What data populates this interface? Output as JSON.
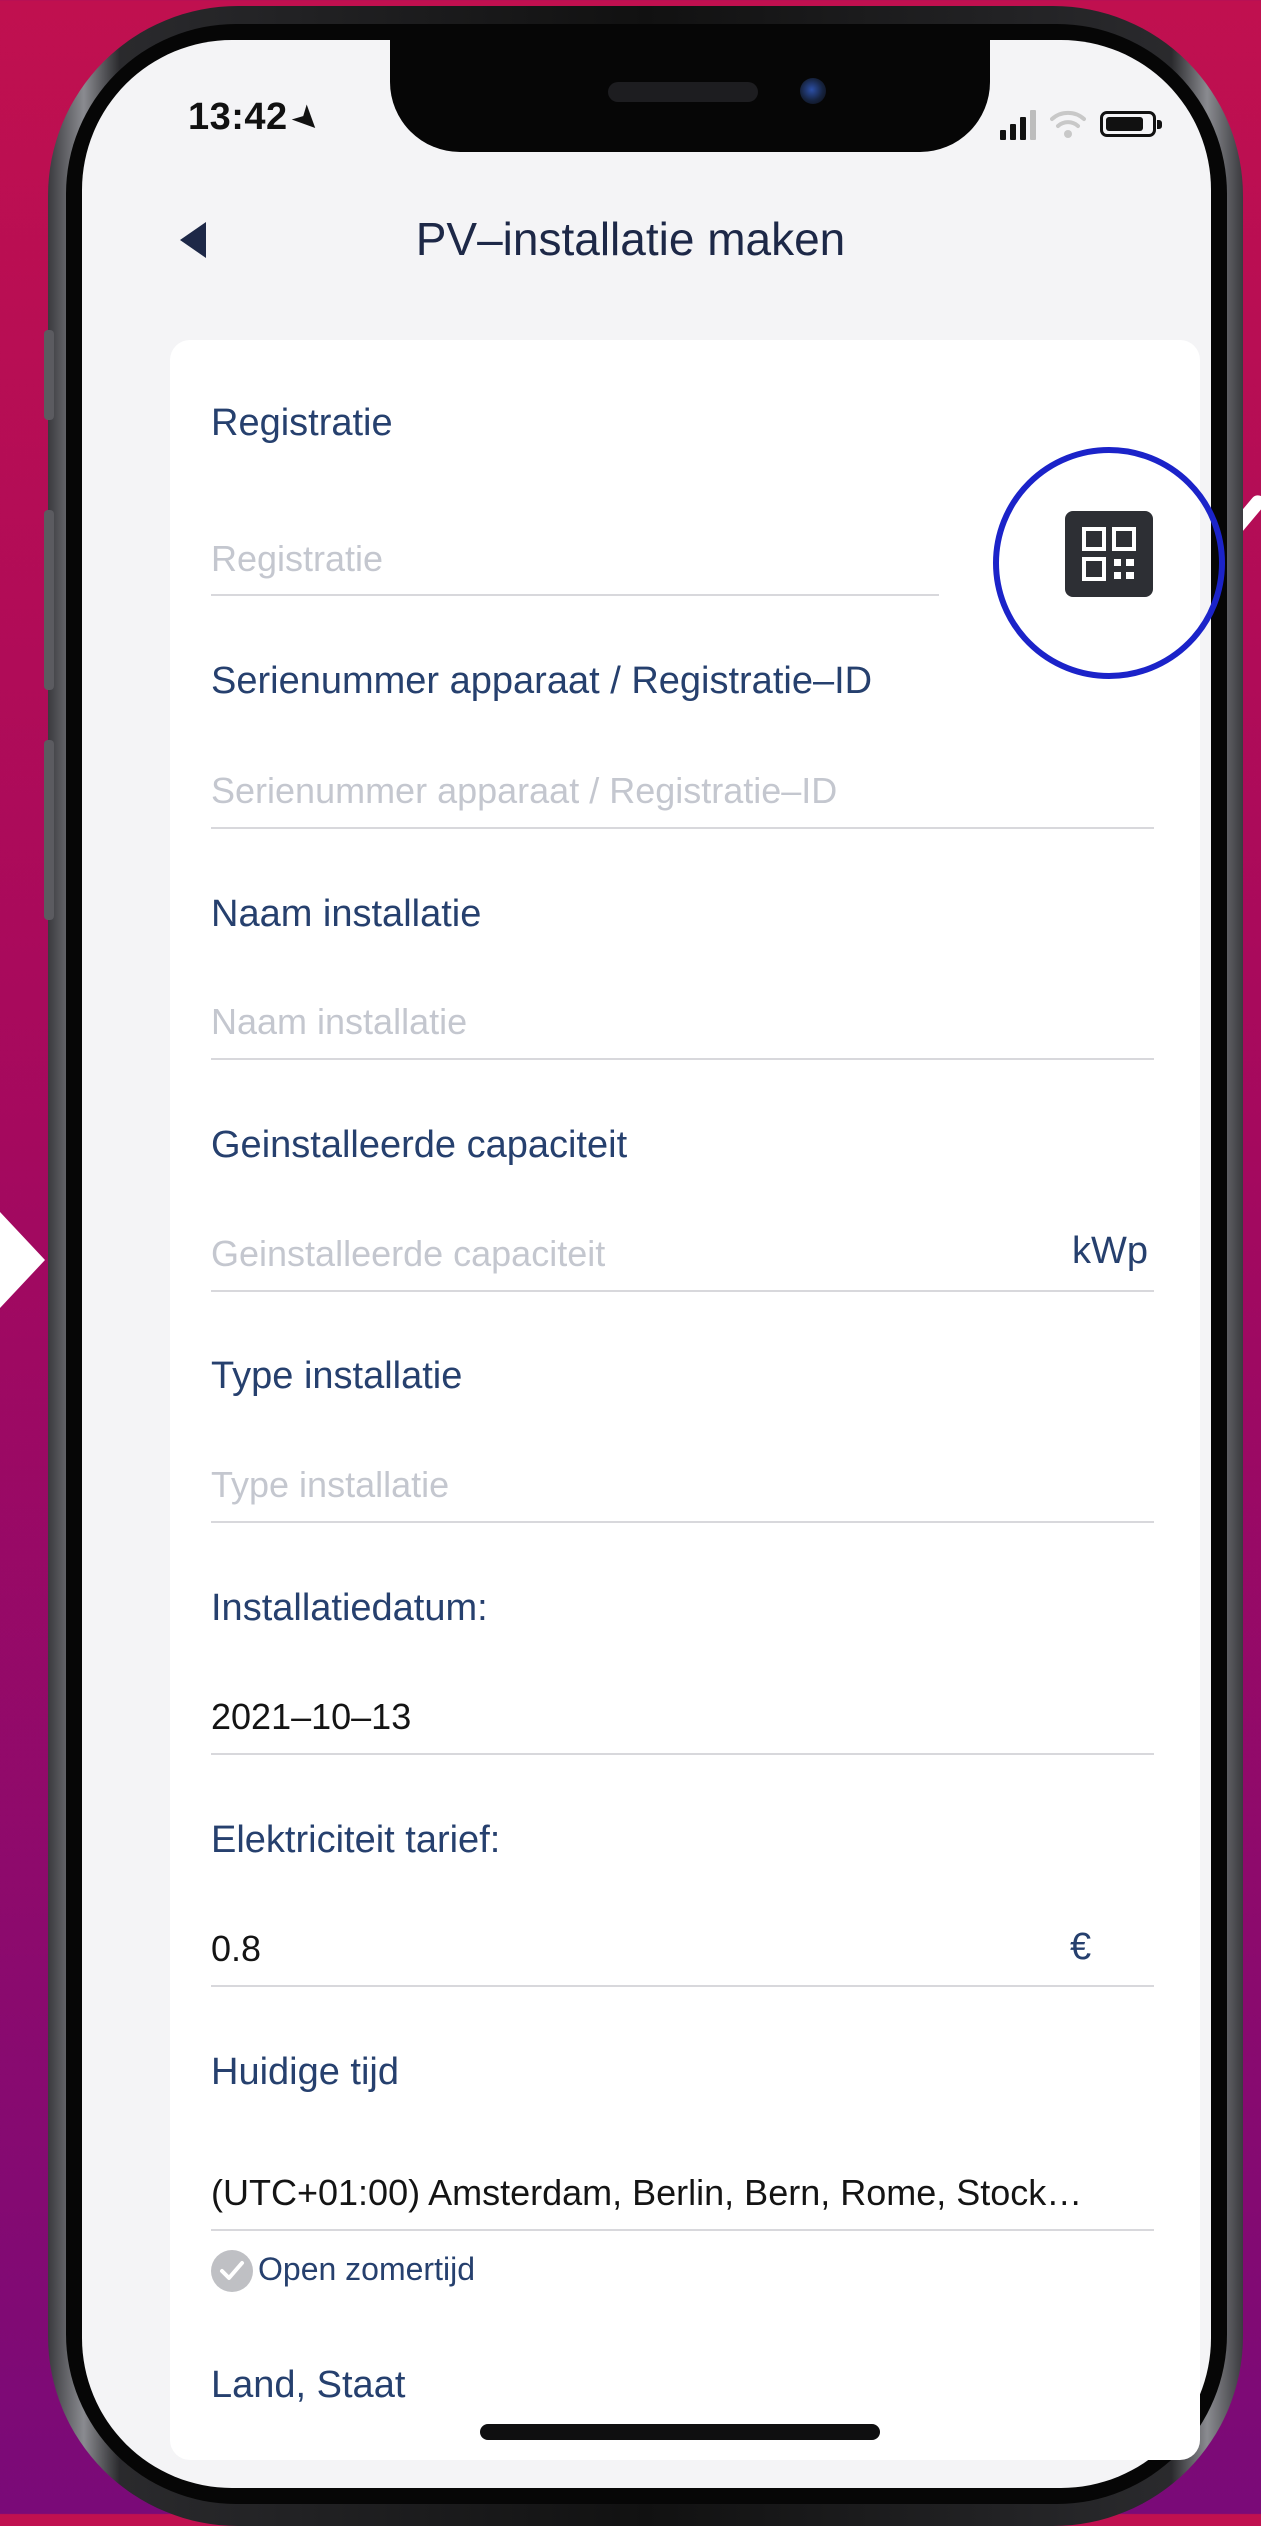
{
  "status_bar": {
    "time": "13:42",
    "location_arrow": "➤"
  },
  "nav": {
    "title": "PV–installatie maken",
    "back_icon": "back-arrow-icon"
  },
  "fields": {
    "registration": {
      "label": "Registratie",
      "placeholder": "Registratie"
    },
    "serial": {
      "label": "Serienummer apparaat / Registratie–ID",
      "placeholder": "Serienummer apparaat / Registratie–ID"
    },
    "plant_name": {
      "label": "Naam installatie",
      "placeholder": "Naam installatie"
    },
    "capacity": {
      "label": "Geinstalleerde capaciteit",
      "placeholder": "Geinstalleerde capaciteit",
      "unit": "kWp"
    },
    "plant_type": {
      "label": "Type installatie",
      "placeholder": "Type installatie"
    },
    "install_date": {
      "label": "Installatiedatum:",
      "value": "2021–10–13"
    },
    "tariff": {
      "label": "Elektriciteit tarief:",
      "value": "0.8",
      "unit": "€"
    },
    "timezone": {
      "label": "Huidige tijd",
      "value": "(UTC+01:00) Amsterdam, Berlin, Bern, Rome, Stock…"
    },
    "dst": {
      "label": "Open zomertijd"
    },
    "country": {
      "label": "Land, Staat"
    }
  },
  "colors": {
    "label": "#26406e",
    "placeholder": "#c4c7cf",
    "highlight": "#1b23c9",
    "background_top": "#c0104f",
    "background_bottom": "#7a0a78"
  },
  "icons": {
    "qr": "qr-code-icon"
  }
}
